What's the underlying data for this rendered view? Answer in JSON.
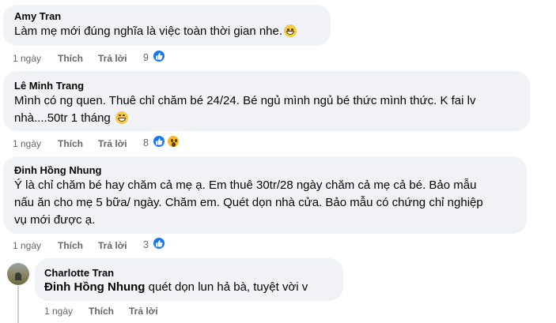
{
  "comments": [
    {
      "author": "Amy Tran",
      "text": "Làm mẹ mới đúng nghĩa là việc toàn thời gian nhe.",
      "time": "1 ngày",
      "like": "Thích",
      "reply": "Trả lời",
      "reactions_count": "9",
      "emoji": "grinning-face-icon",
      "reactions": [
        "like-icon"
      ]
    },
    {
      "author": "Lê Minh Trang",
      "text_line1": "Mình có ng quen. Thuê chỉ chăm bé 24/24. Bé ngủ mình ngủ bé thức mình thức. K fai lv",
      "text_line2": "nhà....50tr 1 tháng",
      "time": "1 ngày",
      "like": "Thích",
      "reply": "Trả lời",
      "reactions_count": "8",
      "emoji": "laughing-face-icon",
      "reactions": [
        "like-icon",
        "wow-icon"
      ]
    },
    {
      "author": "Đinh Hồng Nhung",
      "text_line1": "Ý là chỉ chăm bé hay chăm cả mẹ ạ. Em thuê 30tr/28 ngày chăm cả mẹ cả bé. Bảo mẫu",
      "text_line2": "nấu ăn cho mẹ 5 bữa/ ngày. Chăm em. Quét dọn nhà cửa. Bảo mẫu có chứng chỉ nghiệp",
      "text_line3": "vụ mới được ạ.",
      "time": "1 ngày",
      "like": "Thích",
      "reply": "Trả lời",
      "reactions_count": "3",
      "reactions": [
        "like-icon"
      ]
    }
  ],
  "reply": {
    "author": "Charlotte Tran",
    "mention": "Đinh Hồng Nhung",
    "text": "quét dọn lun hả bà, tuyệt vời v",
    "time": "1 ngày",
    "like": "Thích",
    "reply": "Trả lời"
  },
  "colors": {
    "bubble": "#f0f2f5",
    "like_blue": "#1877f2",
    "meta_gray": "#65676b"
  }
}
